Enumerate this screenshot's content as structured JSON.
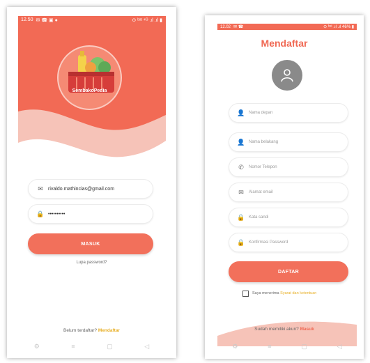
{
  "colors": {
    "primary": "#f26a55",
    "accent": "#e8b028"
  },
  "login": {
    "status": {
      "time": "12.50",
      "icons_right": "⊙ ᵇᵃᵗ ⁴ᴳ .ıl .ıl ▮"
    },
    "logo_text": "SembakoPedia",
    "email_value": "rivaldo.mathincias@gmail.com",
    "password_value": "••••••••••",
    "login_button": "MASUK",
    "forgot_link": "Lupa password?",
    "register_prompt": "Belum terdaftar?",
    "register_link": "Mendaftar",
    "icons": {
      "email": "email-icon",
      "password": "lock-icon"
    }
  },
  "register": {
    "status": {
      "time": "12.02",
      "icons_right": "⊙ ᵇᵃᵗ .ıl .ıl 46% ▮"
    },
    "title": "Mendaftar",
    "fields": [
      {
        "placeholder": "Nama depan",
        "icon": "person-icon"
      },
      {
        "placeholder": "Nama belakang",
        "icon": "person-icon"
      },
      {
        "placeholder": "Nomor Telepon",
        "icon": "phone-icon"
      },
      {
        "placeholder": "Alamat email",
        "icon": "email-icon"
      },
      {
        "placeholder": "Kata sandi",
        "icon": "lock-icon"
      },
      {
        "placeholder": "Konfirmasi Password",
        "icon": "lock-icon"
      }
    ],
    "submit_button": "DAFTAR",
    "terms_text": "Saya menerima",
    "terms_link": "Syarat dan ketentuan",
    "login_prompt": "Sudah memiliki akun?",
    "login_link": "Masuk"
  }
}
